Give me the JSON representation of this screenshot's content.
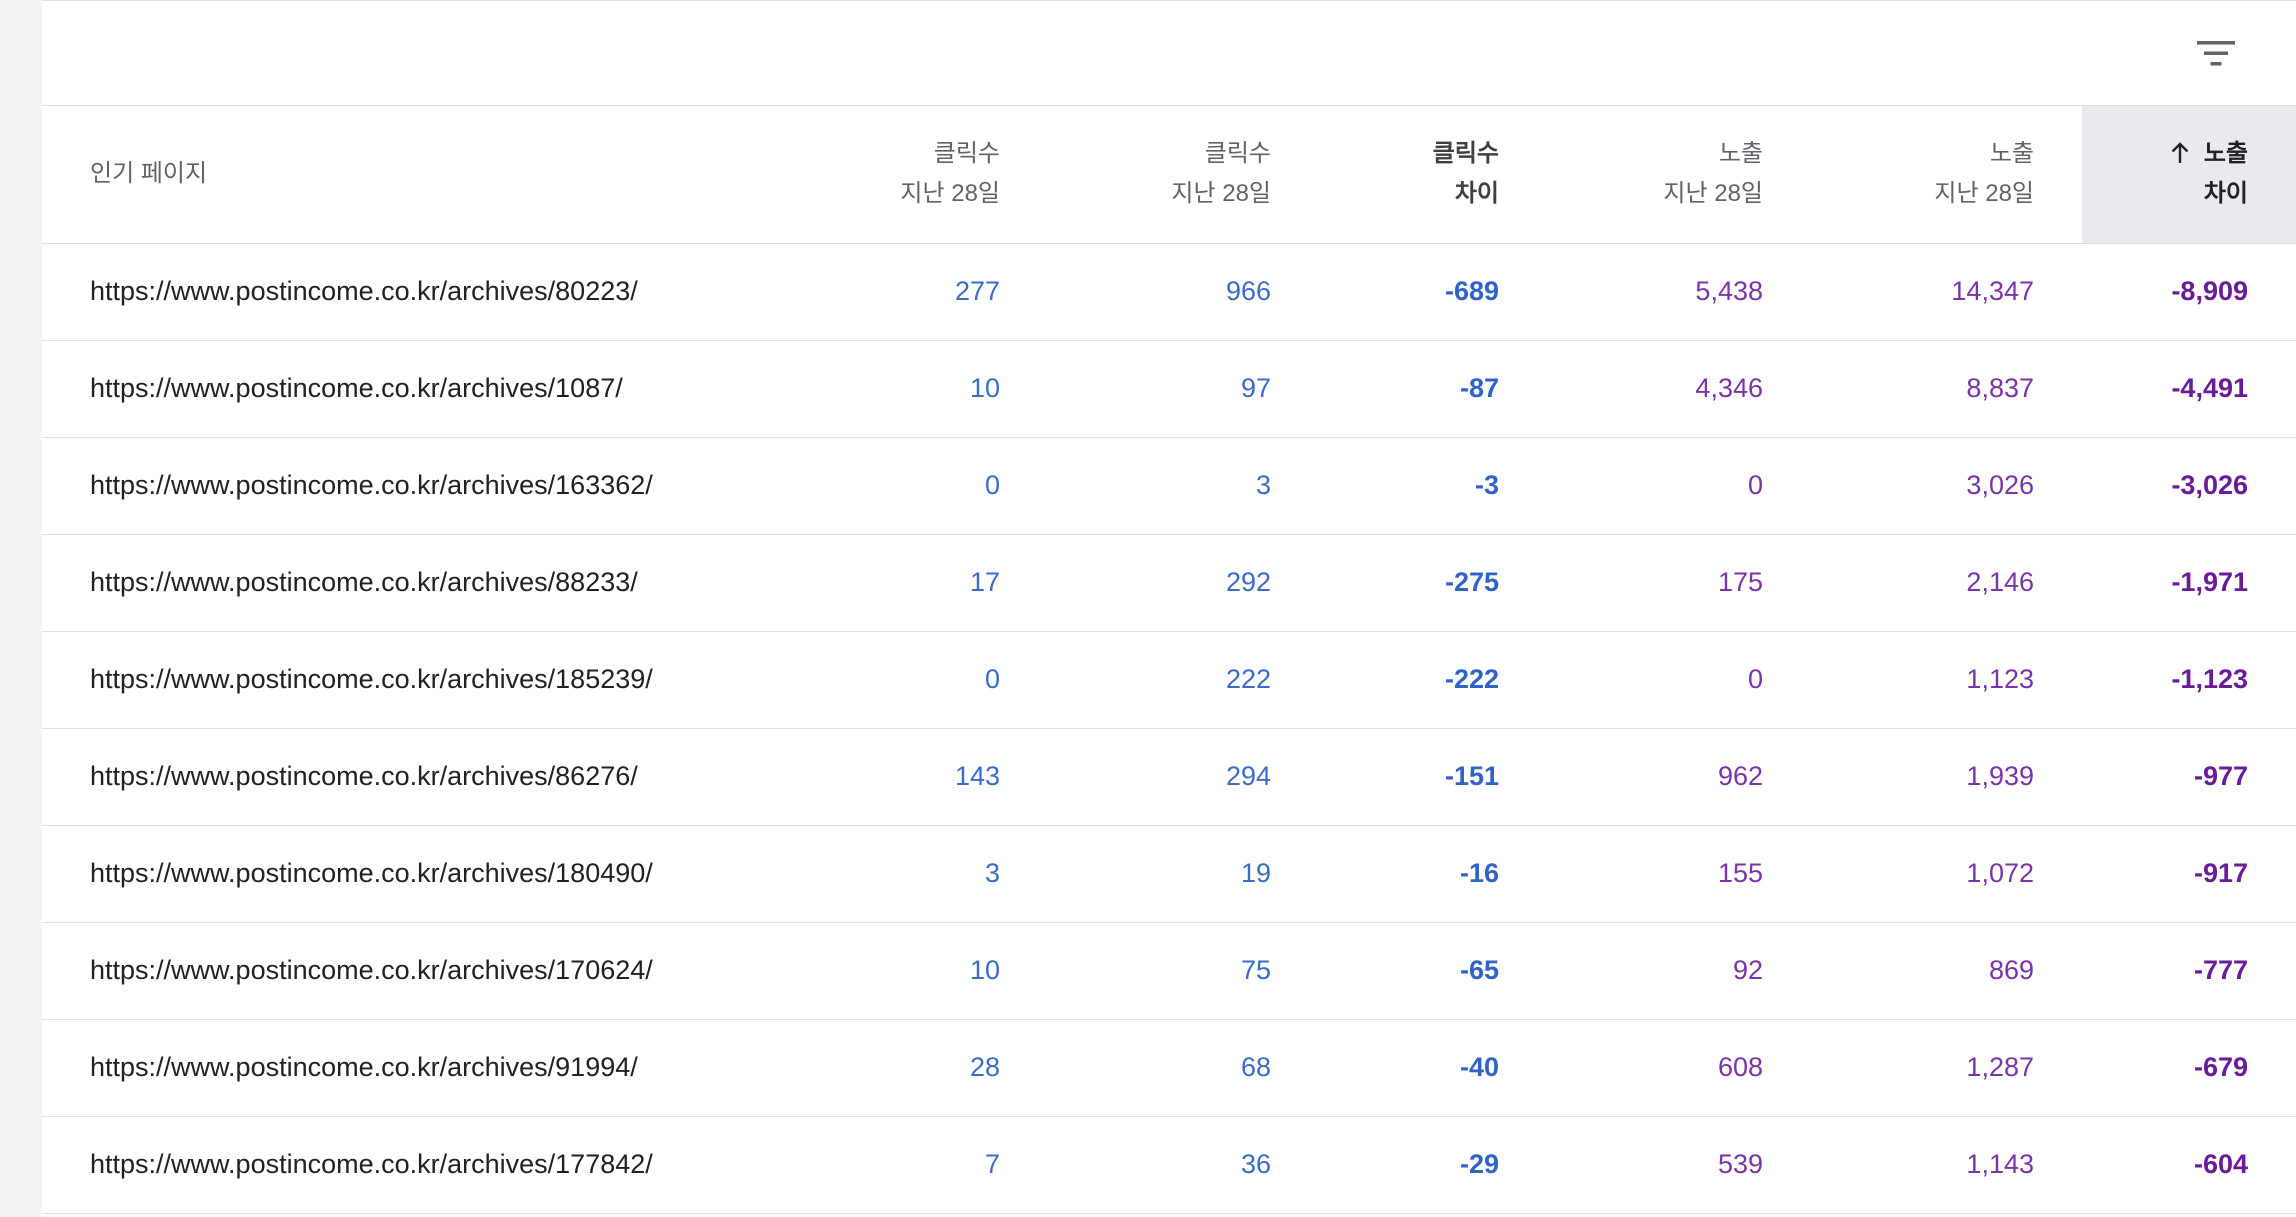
{
  "toolbar": {
    "filter_icon": "filter-list-icon"
  },
  "columns": {
    "page": "인기 페이지",
    "clicks_a": [
      "클릭수",
      "지난 28일"
    ],
    "clicks_b": [
      "클릭수",
      "지난 28일"
    ],
    "clicks_diff": [
      "클릭수",
      "차이"
    ],
    "impr_a": [
      "노출",
      "지난 28일"
    ],
    "impr_b": [
      "노출",
      "지난 28일"
    ],
    "impr_diff": [
      "노출",
      "차이"
    ],
    "sort_icon": "arrow-upward-icon"
  },
  "rows": [
    {
      "page": "https://www.postincome.co.kr/archives/80223/",
      "c1": "277",
      "c2": "966",
      "cd": "-689",
      "i1": "5,438",
      "i2": "14,347",
      "id": "-8,909"
    },
    {
      "page": "https://www.postincome.co.kr/archives/1087/",
      "c1": "10",
      "c2": "97",
      "cd": "-87",
      "i1": "4,346",
      "i2": "8,837",
      "id": "-4,491"
    },
    {
      "page": "https://www.postincome.co.kr/archives/163362/",
      "c1": "0",
      "c2": "3",
      "cd": "-3",
      "i1": "0",
      "i2": "3,026",
      "id": "-3,026"
    },
    {
      "page": "https://www.postincome.co.kr/archives/88233/",
      "c1": "17",
      "c2": "292",
      "cd": "-275",
      "i1": "175",
      "i2": "2,146",
      "id": "-1,971"
    },
    {
      "page": "https://www.postincome.co.kr/archives/185239/",
      "c1": "0",
      "c2": "222",
      "cd": "-222",
      "i1": "0",
      "i2": "1,123",
      "id": "-1,123"
    },
    {
      "page": "https://www.postincome.co.kr/archives/86276/",
      "c1": "143",
      "c2": "294",
      "cd": "-151",
      "i1": "962",
      "i2": "1,939",
      "id": "-977"
    },
    {
      "page": "https://www.postincome.co.kr/archives/180490/",
      "c1": "3",
      "c2": "19",
      "cd": "-16",
      "i1": "155",
      "i2": "1,072",
      "id": "-917"
    },
    {
      "page": "https://www.postincome.co.kr/archives/170624/",
      "c1": "10",
      "c2": "75",
      "cd": "-65",
      "i1": "92",
      "i2": "869",
      "id": "-777"
    },
    {
      "page": "https://www.postincome.co.kr/archives/91994/",
      "c1": "28",
      "c2": "68",
      "cd": "-40",
      "i1": "608",
      "i2": "1,287",
      "id": "-679"
    },
    {
      "page": "https://www.postincome.co.kr/archives/177842/",
      "c1": "7",
      "c2": "36",
      "cd": "-29",
      "i1": "539",
      "i2": "1,143",
      "id": "-604"
    }
  ],
  "colors": {
    "clicks": "#3a6bc9",
    "impressions": "#7a33a8",
    "sorted_header_bg": "#e8eaed"
  }
}
